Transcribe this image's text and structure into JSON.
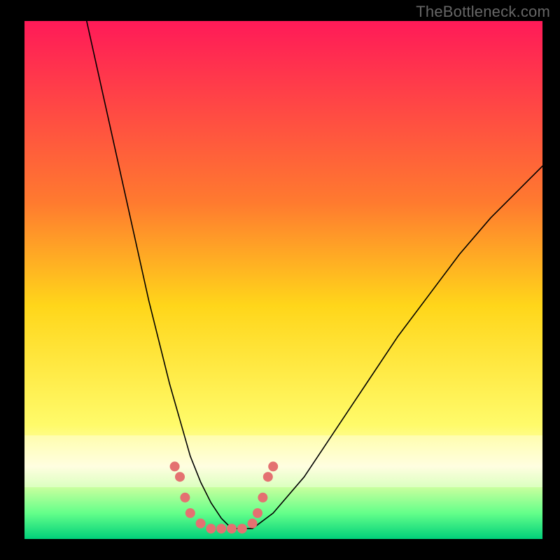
{
  "watermark": "TheBottleneck.com",
  "chart_data": {
    "type": "line",
    "title": "",
    "xlabel": "",
    "ylabel": "",
    "xlim": [
      0,
      100
    ],
    "ylim": [
      0,
      100
    ],
    "grid": false,
    "background": {
      "gradient_stops": [
        {
          "pos": 0.0,
          "color": "#ff1a58"
        },
        {
          "pos": 0.35,
          "color": "#ff7a2f"
        },
        {
          "pos": 0.55,
          "color": "#ffd61a"
        },
        {
          "pos": 0.78,
          "color": "#fffb6a"
        },
        {
          "pos": 0.86,
          "color": "#fffed0"
        },
        {
          "pos": 0.9,
          "color": "#c9ff9e"
        },
        {
          "pos": 0.95,
          "color": "#64ff8a"
        },
        {
          "pos": 1.0,
          "color": "#00d07a"
        }
      ]
    },
    "series": [
      {
        "name": "bottleneck-curve",
        "stroke": "#000000",
        "stroke_width": 1.6,
        "x": [
          12,
          14,
          16,
          18,
          20,
          22,
          24,
          26,
          28,
          30,
          32,
          34,
          36,
          38,
          40,
          44,
          48,
          54,
          60,
          66,
          72,
          78,
          84,
          90,
          96,
          100
        ],
        "y": [
          100,
          91,
          82,
          73,
          64,
          55,
          46,
          38,
          30,
          23,
          16,
          11,
          7,
          4,
          2,
          2,
          5,
          12,
          21,
          30,
          39,
          47,
          55,
          62,
          68,
          72
        ]
      }
    ],
    "markers": [
      {
        "name": "left-cluster",
        "color": "#e47171",
        "radius": 7,
        "points": [
          {
            "x": 29,
            "y": 14
          },
          {
            "x": 30,
            "y": 12
          },
          {
            "x": 31,
            "y": 8
          },
          {
            "x": 32,
            "y": 5
          },
          {
            "x": 34,
            "y": 3
          },
          {
            "x": 36,
            "y": 2
          }
        ]
      },
      {
        "name": "valley-cluster",
        "color": "#e47171",
        "radius": 7,
        "points": [
          {
            "x": 38,
            "y": 2
          },
          {
            "x": 40,
            "y": 2
          },
          {
            "x": 42,
            "y": 2
          },
          {
            "x": 44,
            "y": 3
          }
        ]
      },
      {
        "name": "right-cluster",
        "color": "#e47171",
        "radius": 7,
        "points": [
          {
            "x": 45,
            "y": 5
          },
          {
            "x": 46,
            "y": 8
          },
          {
            "x": 47,
            "y": 12
          },
          {
            "x": 48,
            "y": 14
          }
        ]
      }
    ]
  }
}
